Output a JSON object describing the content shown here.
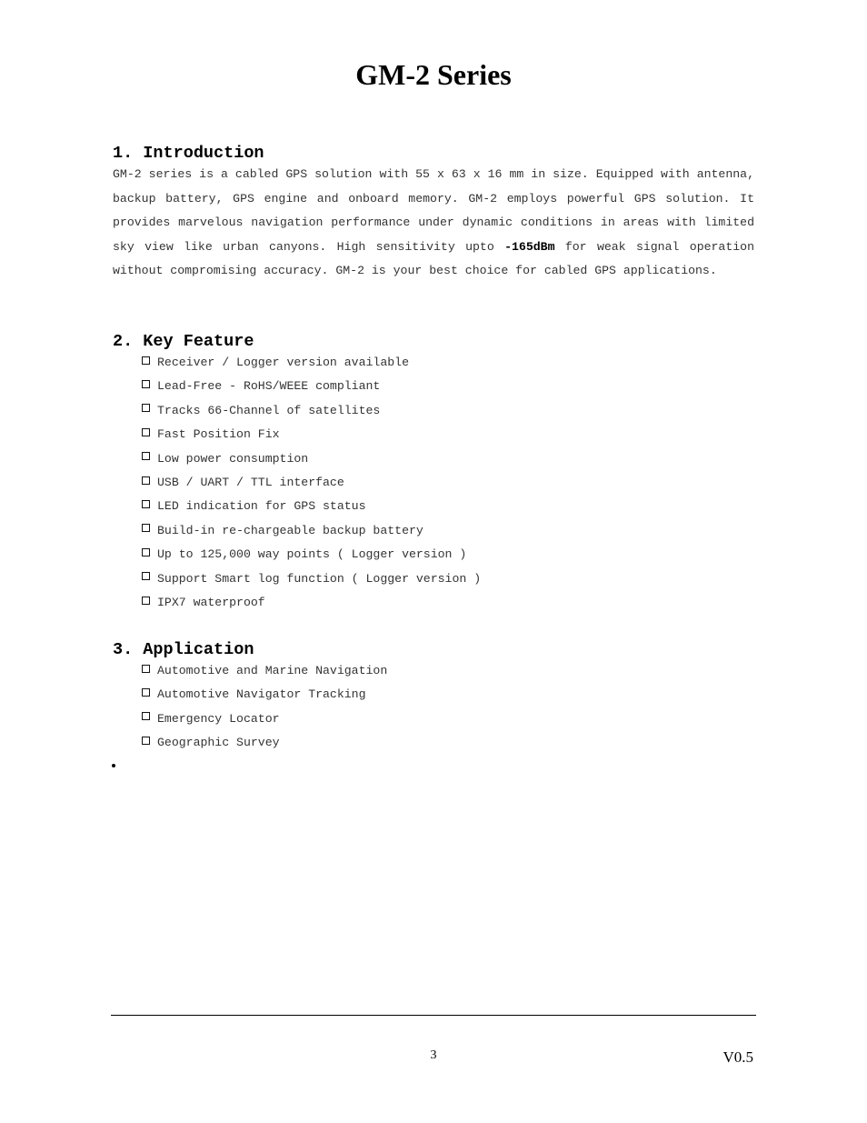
{
  "title": "GM-2 Series",
  "sections": {
    "introduction": {
      "heading": "1. Introduction",
      "text_before": "GM-2 series is a cabled GPS solution with 55 x 63 x 16 mm in size. Equipped with antenna, backup battery, GPS engine and onboard memory. GM-2 employs powerful GPS solution. It provides marvelous navigation performance under dynamic conditions in areas with limited sky view like urban canyons. High sensitivity upto ",
      "bold": "-165dBm",
      "text_after": " for weak signal operation without compromising accuracy. GM-2 is your best choice for cabled GPS applications."
    },
    "key_feature": {
      "heading": "2. Key Feature",
      "items": [
        "Receiver / Logger version available",
        "Lead-Free - RoHS/WEEE compliant",
        "Tracks 66-Channel of satellites",
        "Fast Position Fix",
        "Low power consumption",
        "USB / UART / TTL interface",
        "LED indication for GPS status",
        "Build-in re-chargeable backup battery",
        "Up to 125,000 way points ( Logger version )",
        "Support Smart log function ( Logger version )",
        "IPX7 waterproof"
      ]
    },
    "application": {
      "heading": "3. Application",
      "items": [
        "Automotive and Marine Navigation",
        "Automotive Navigator Tracking",
        "Emergency Locator",
        "Geographic Survey"
      ]
    }
  },
  "footer": {
    "page_number": "3",
    "version": "V0.5"
  }
}
